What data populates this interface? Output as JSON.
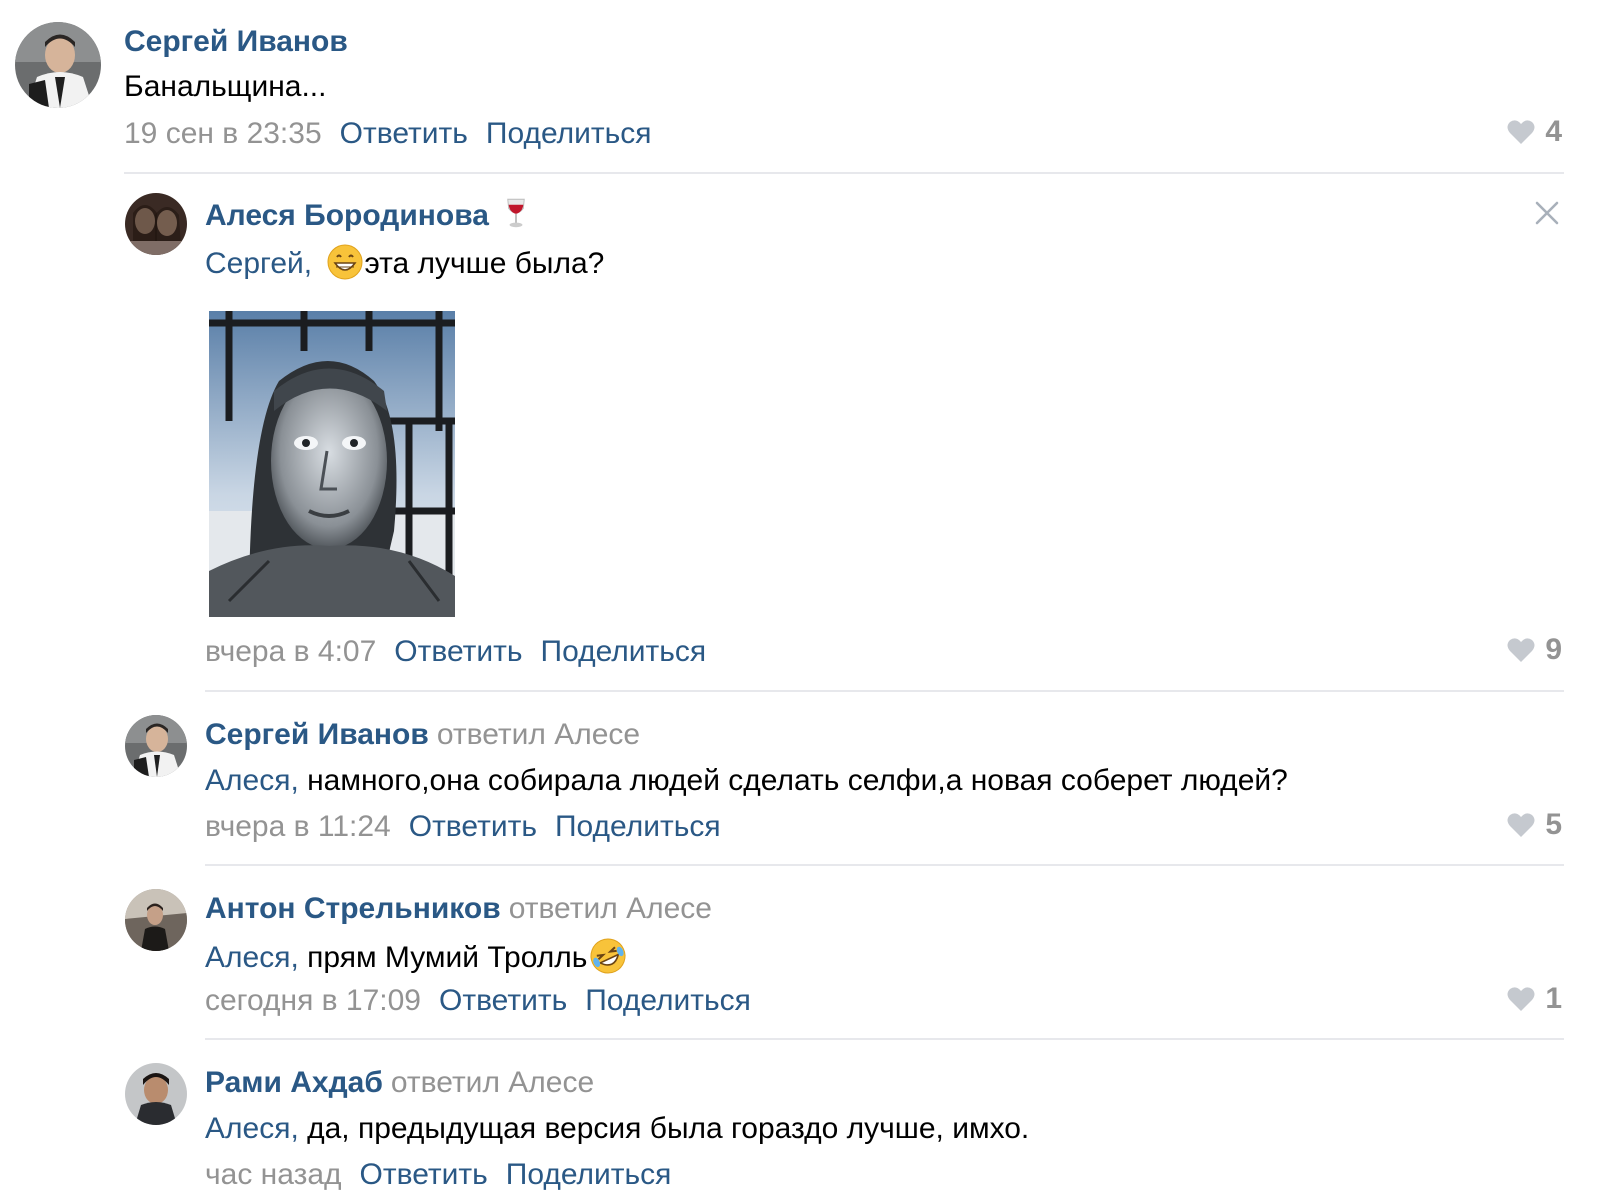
{
  "comments": [
    {
      "author": "Сергей Иванов",
      "text": "Банальщина...",
      "time": "19 сен в 23:35",
      "reply": "Ответить",
      "share": "Поделиться",
      "likes": "4"
    },
    {
      "author": "Алеся Бородинова",
      "author_emoji": "wine-glass-icon",
      "mention": "Сергей,",
      "text": "эта лучше была?",
      "text_emoji": "grinning-face-icon",
      "photo": "statue-face-photo",
      "time": "вчера в 4:07",
      "reply": "Ответить",
      "share": "Поделиться",
      "likes": "9"
    },
    {
      "author": "Сергей Иванов",
      "replied": "ответил Алесе",
      "mention": "Алеся,",
      "text": " намного,она собирала людей сделать селфи,а новая соберет людей?",
      "time": "вчера в 11:24",
      "reply": "Ответить",
      "share": "Поделиться",
      "likes": "5"
    },
    {
      "author": "Антон Стрельников",
      "replied": "ответил Алесе",
      "mention": "Алеся,",
      "text": " прям Мумий Тролль",
      "text_emoji": "rolling-laughing-face-icon",
      "time": "сегодня в 17:09",
      "reply": "Ответить",
      "share": "Поделиться",
      "likes": "1"
    },
    {
      "author": "Рами Ахдаб",
      "replied": "ответил Алесе",
      "mention": "Алеся,",
      "text": " да, предыдущая версия была гораздо лучше, имхо.",
      "time": "час назад",
      "reply": "Ответить",
      "share": "Поделиться"
    }
  ],
  "colors": {
    "link": "#2a5885",
    "muted": "#939393",
    "divider": "#e7e8ec"
  },
  "icons": {
    "like": "heart-icon",
    "close": "close-icon"
  }
}
